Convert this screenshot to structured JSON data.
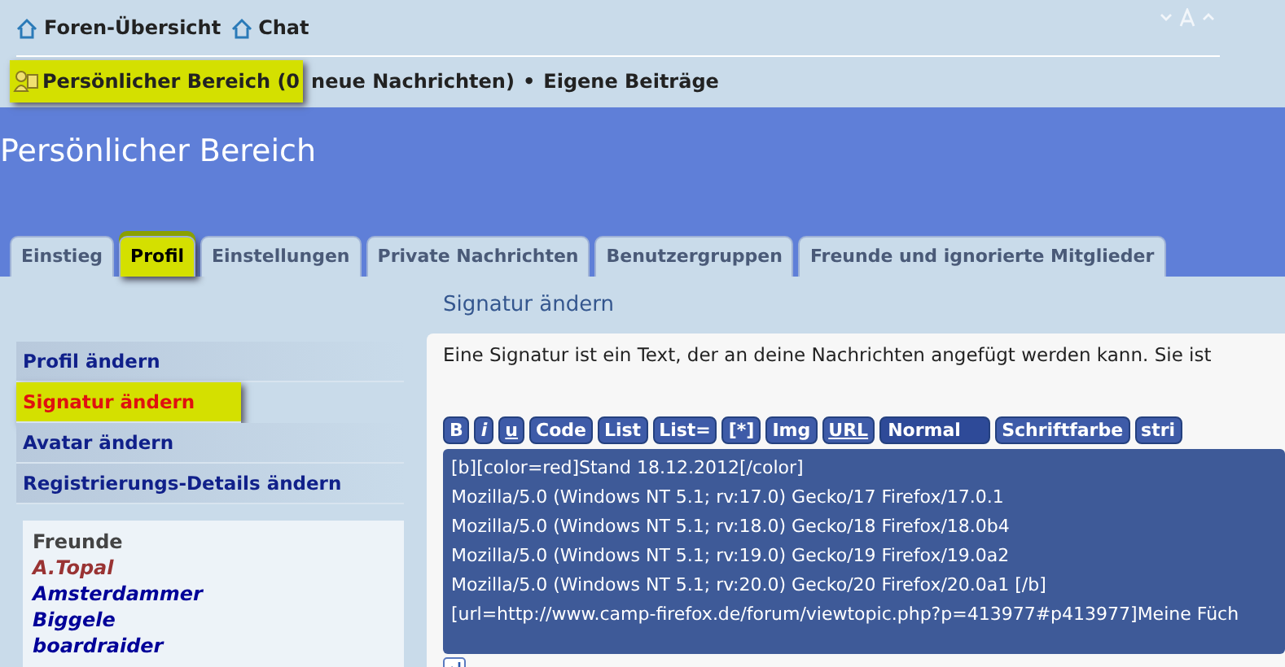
{
  "nav": {
    "links": [
      {
        "label": "Foren-Übersicht"
      },
      {
        "label": "Chat"
      }
    ]
  },
  "user_bar": {
    "highlighted": true,
    "label": "Persönlicher Bereich (0",
    "rest": "neue Nachrichten)",
    "separator": "•",
    "link": "Eigene Beiträge"
  },
  "page_title": "Persönlicher Bereich",
  "tabs": [
    {
      "label": "Einstieg",
      "selected": false
    },
    {
      "label": "Profil",
      "selected": true
    },
    {
      "label": "Einstellungen",
      "selected": false
    },
    {
      "label": "Private Nachrichten",
      "selected": false
    },
    {
      "label": "Benutzergruppen",
      "selected": false
    },
    {
      "label": "Freunde und ignorierte Mitglieder",
      "selected": false
    }
  ],
  "section_title": "Signatur ändern",
  "menu": [
    {
      "label": "Profil ändern",
      "selected": false
    },
    {
      "label": "Signatur ändern",
      "selected": true
    },
    {
      "label": "Avatar ändern",
      "selected": false
    },
    {
      "label": "Registrierungs-Details ändern",
      "selected": false
    }
  ],
  "friends": {
    "title": "Freunde",
    "items": [
      {
        "name": "A.Topal",
        "color": "#993333"
      },
      {
        "name": "Amsterdammer",
        "color": "#000099"
      },
      {
        "name": "Biggele",
        "color": "#000099"
      },
      {
        "name": "boardraider",
        "color": "#000099"
      }
    ]
  },
  "intro": "Eine Signatur ist ein Text, der an deine Nachrichten angefügt werden kann. Sie ist",
  "toolbar": [
    {
      "label": "B",
      "kind": "bold"
    },
    {
      "label": "i",
      "kind": "italic"
    },
    {
      "label": "u",
      "kind": "underline"
    },
    {
      "label": "Code",
      "kind": "plain"
    },
    {
      "label": "List",
      "kind": "plain"
    },
    {
      "label": "List=",
      "kind": "plain"
    },
    {
      "label": "[*]",
      "kind": "plain"
    },
    {
      "label": "Img",
      "kind": "plain"
    },
    {
      "label": "URL",
      "kind": "underline"
    },
    {
      "label": "Normal",
      "kind": "select"
    },
    {
      "label": "Schriftfarbe",
      "kind": "plain"
    },
    {
      "label": "stri",
      "kind": "plain"
    }
  ],
  "signature_lines": [
    "[b][color=red]Stand 18.12.2012[/color]",
    "Mozilla/5.0 (Windows NT 5.1; rv:17.0) Gecko/17 Firefox/17.0.1",
    "Mozilla/5.0 (Windows NT 5.1; rv:18.0) Gecko/18 Firefox/18.0b4",
    "Mozilla/5.0 (Windows NT 5.1; rv:19.0) Gecko/19 Firefox/19.0a2",
    "Mozilla/5.0 (Windows NT 5.1; rv:20.0) Gecko/20 Firefox/20.0a1 [/b]",
    "[url=http://www.camp-firefox.de/forum/viewtopic.php?p=413977#p413977]Meine Füch"
  ]
}
